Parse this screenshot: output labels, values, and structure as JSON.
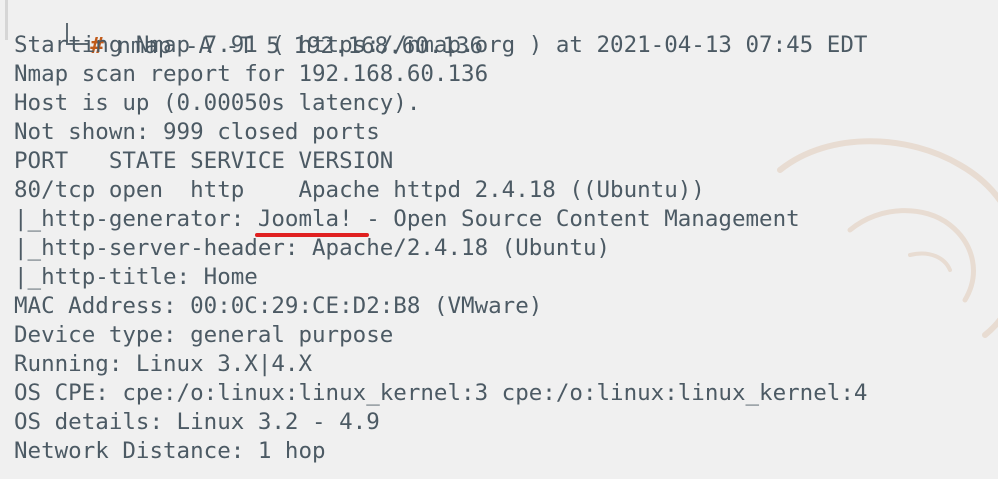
{
  "terminal": {
    "command_prompt_symbol": "#",
    "command": " nmap -A -T 5 192.168.60.136",
    "output_lines": [
      "Starting Nmap 7.91 ( https://nmap.org ) at 2021-04-13 07:45 EDT",
      "Nmap scan report for 192.168.60.136",
      "Host is up (0.00050s latency).",
      "Not shown: 999 closed ports",
      "PORT   STATE SERVICE VERSION",
      "80/tcp open  http    Apache httpd 2.4.18 ((Ubuntu))",
      "|_http-generator: Joomla! - Open Source Content Management",
      "|_http-server-header: Apache/2.4.18 (Ubuntu)",
      "|_http-title: Home",
      "MAC Address: 00:0C:29:CE:D2:B8 (VMware)",
      "Device type: general purpose",
      "Running: Linux 3.X|4.X",
      "OS CPE: cpe:/o:linux:linux_kernel:3 cpe:/o:linux:linux_kernel:4",
      "OS details: Linux 3.2 - 4.9",
      "Network Distance: 1 hop"
    ]
  },
  "colors": {
    "background": "#f0f0f0",
    "text": "#4c5a64",
    "prompt_hash": "#c15a1a",
    "highlight_underline": "#e02020"
  }
}
